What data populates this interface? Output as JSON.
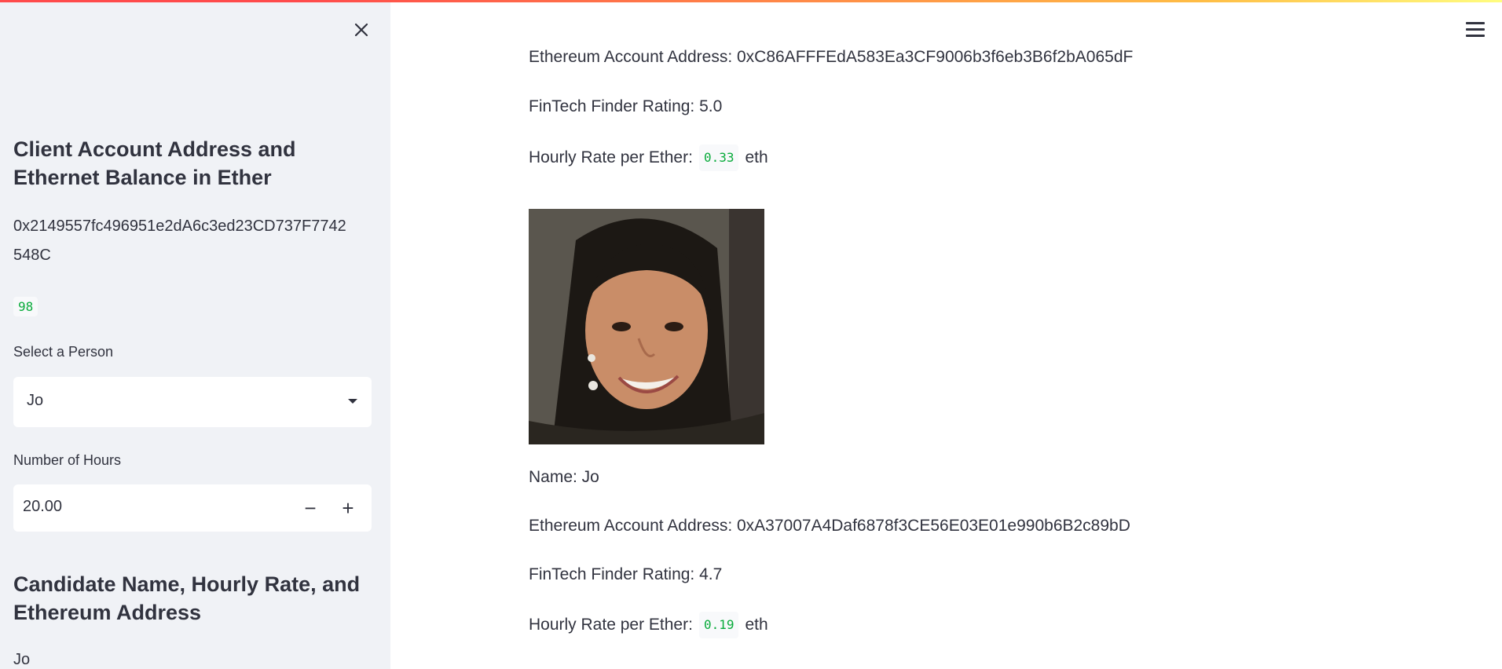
{
  "sidebar": {
    "heading_balance": "Client Account Address and Ethernet Balance in Ether",
    "client_address_line1": "0x2149557fc496951e2dA6c3ed23CD737F7742",
    "client_address_line2": "548C",
    "balance": "98",
    "select_label": "Select a Person",
    "select_value": "Jo",
    "hours_label": "Number of Hours",
    "hours_value": "20.00",
    "minus_label": "−",
    "plus_label": "+",
    "heading_candidate": "Candidate Name, Hourly Rate, and Ethereum Address",
    "candidate_name": "Jo"
  },
  "main": {
    "prev_candidate": {
      "address_line": "Ethereum Account Address: 0xC86AFFFEdA583Ea3CF9006b3f6eb3B6f2bA065dF",
      "rating_line": "FinTech Finder Rating: 5.0",
      "rate_prefix": "Hourly Rate per Ether:",
      "rate_value": "0.33",
      "rate_unit": "eth"
    },
    "candidate": {
      "name_line": "Name: Jo",
      "address_line": "Ethereum Account Address: 0xA37007A4Daf6878f3CE56E03E01e990b6B2c89bD",
      "rating_line": "FinTech Finder Rating: 4.7",
      "rate_prefix": "Hourly Rate per Ether:",
      "rate_value": "0.19",
      "rate_unit": "eth"
    }
  },
  "icons": {
    "close": "close-icon",
    "menu": "hamburger-menu-icon",
    "caret": "chevron-down-icon"
  },
  "colors": {
    "code_green": "#09ab3b",
    "sidebar_bg": "#f0f2f6",
    "text": "#31333f"
  }
}
